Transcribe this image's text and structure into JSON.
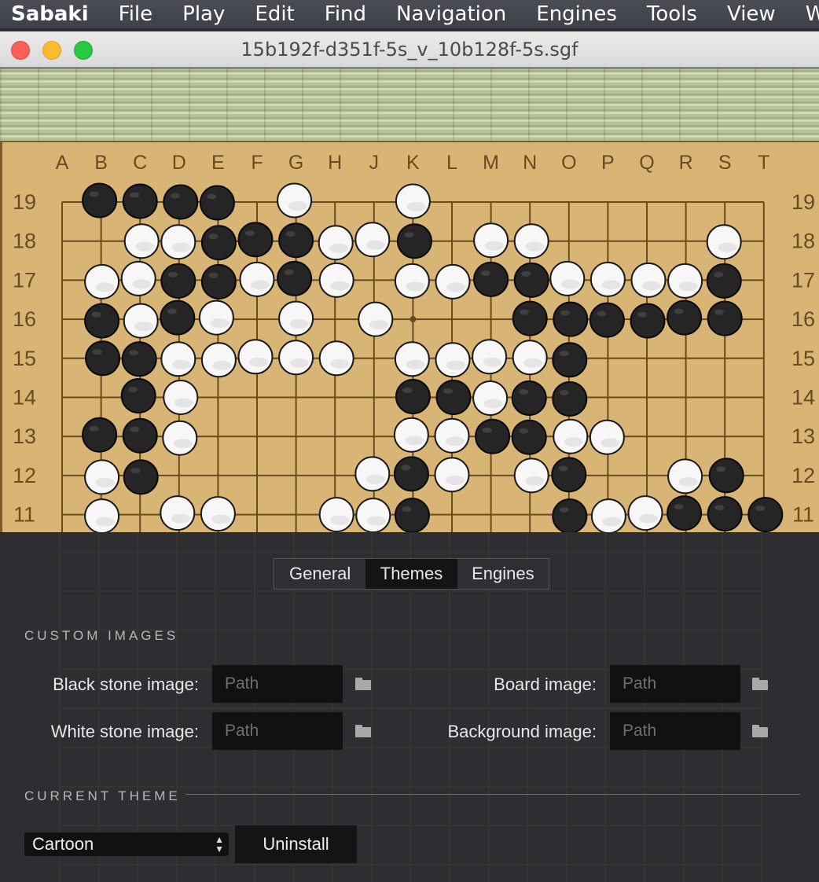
{
  "menubar": {
    "app_name": "Sabaki",
    "items": [
      "File",
      "Play",
      "Edit",
      "Find",
      "Navigation",
      "Engines",
      "Tools",
      "View",
      "Wi"
    ]
  },
  "window": {
    "title": "15b192f-d351f-5s_v_10b128f-5s.sgf"
  },
  "board": {
    "columns": [
      "A",
      "B",
      "C",
      "D",
      "E",
      "F",
      "G",
      "H",
      "J",
      "K",
      "L",
      "M",
      "N",
      "O",
      "P",
      "Q",
      "R",
      "S",
      "T"
    ],
    "rows_visible": [
      "19",
      "18",
      "17",
      "16",
      "15",
      "14",
      "13",
      "12",
      "11"
    ],
    "star_points": [
      "K16"
    ],
    "black_stones": [
      "B19",
      "C19",
      "D19",
      "E19",
      "E18",
      "F18",
      "G18",
      "K18",
      "D17",
      "E17",
      "G17",
      "M17",
      "N17",
      "S17",
      "B16",
      "D16",
      "N16",
      "O16",
      "P16",
      "Q16",
      "R16",
      "S16",
      "B15",
      "C15",
      "O15",
      "C14",
      "K14",
      "L14",
      "N14",
      "O14",
      "B13",
      "C13",
      "M13",
      "N13",
      "C12",
      "K12",
      "O12",
      "S12",
      "K11",
      "O11",
      "R11",
      "S11",
      "T11"
    ],
    "white_stones": [
      "G19",
      "K19",
      "C18",
      "D18",
      "H18",
      "J18",
      "M18",
      "N18",
      "S18",
      "B17",
      "C17",
      "F17",
      "H17",
      "K17",
      "L17",
      "O17",
      "P17",
      "Q17",
      "R17",
      "C16",
      "E16",
      "G16",
      "J16",
      "D15",
      "E15",
      "F15",
      "G15",
      "H15",
      "K15",
      "L15",
      "M15",
      "N15",
      "D14",
      "M14",
      "D13",
      "K13",
      "L13",
      "O13",
      "P13",
      "B12",
      "J12",
      "L12",
      "N12",
      "R12",
      "B11",
      "D11",
      "E11",
      "H11",
      "J11",
      "P11",
      "Q11"
    ]
  },
  "preferences": {
    "tabs": [
      {
        "label": "General",
        "active": false
      },
      {
        "label": "Themes",
        "active": true
      },
      {
        "label": "Engines",
        "active": false
      }
    ],
    "custom_images": {
      "heading": "CUSTOM IMAGES",
      "black_stone_label": "Black stone image:",
      "white_stone_label": "White stone image:",
      "board_label": "Board image:",
      "background_label": "Background image:",
      "path_placeholder": "Path"
    },
    "current_theme": {
      "heading": "CURRENT THEME",
      "selected": "Cartoon",
      "uninstall_label": "Uninstall"
    }
  }
}
